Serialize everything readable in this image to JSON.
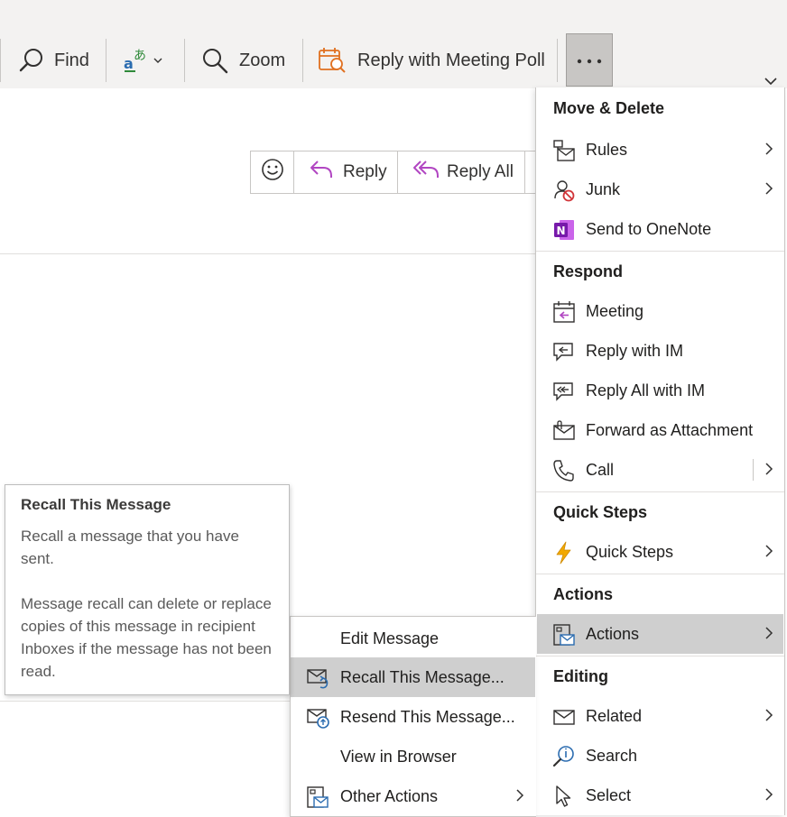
{
  "ribbon": {
    "find_label": "Find",
    "zoom_label": "Zoom",
    "meeting_poll_label": "Reply with Meeting Poll",
    "more_icon": "ellipsis-icon"
  },
  "response_bar": {
    "reply_label": "Reply",
    "reply_all_label": "Reply All"
  },
  "menu": {
    "move_delete": {
      "header": "Move & Delete",
      "items": [
        {
          "label": "Rules",
          "icon": "rules-icon",
          "submenu": true
        },
        {
          "label": "Junk",
          "icon": "junk-icon",
          "submenu": true
        },
        {
          "label": "Send to OneNote",
          "icon": "onenote-icon",
          "submenu": false
        }
      ]
    },
    "respond": {
      "header": "Respond",
      "items": [
        {
          "label": "Meeting",
          "icon": "meeting-icon",
          "submenu": false
        },
        {
          "label": "Reply with IM",
          "icon": "reply-im-icon",
          "submenu": false
        },
        {
          "label": "Reply All with IM",
          "icon": "reply-all-im-icon",
          "submenu": false
        },
        {
          "label": "Forward as Attachment",
          "icon": "forward-attachment-icon",
          "submenu": false
        },
        {
          "label": "Call",
          "icon": "phone-icon",
          "submenu": true
        }
      ]
    },
    "quick_steps": {
      "header": "Quick Steps",
      "items": [
        {
          "label": "Quick Steps",
          "icon": "lightning-icon",
          "submenu": true
        }
      ]
    },
    "actions": {
      "header": "Actions",
      "items": [
        {
          "label": "Actions",
          "icon": "actions-icon",
          "submenu": true,
          "selected": true
        }
      ]
    },
    "editing": {
      "header": "Editing",
      "items": [
        {
          "label": "Related",
          "icon": "related-icon",
          "submenu": true
        },
        {
          "label": "Search",
          "icon": "search-icon",
          "submenu": false
        },
        {
          "label": "Select",
          "icon": "select-cursor-icon",
          "submenu": true
        }
      ]
    }
  },
  "actions_submenu": {
    "items": [
      {
        "label": "Edit Message",
        "icon": "",
        "submenu": false
      },
      {
        "label": "Recall This Message...",
        "icon": "recall-icon",
        "submenu": false,
        "selected": true
      },
      {
        "label": "Resend This Message...",
        "icon": "resend-icon",
        "submenu": false
      },
      {
        "label": "View in Browser",
        "icon": "",
        "submenu": false
      },
      {
        "label": "Other Actions",
        "icon": "other-actions-icon",
        "submenu": true
      }
    ]
  },
  "tooltip": {
    "title": "Recall This Message",
    "line1": "Recall a message that you have sent.",
    "line2": "Message recall can delete or replace copies of this message in recipient Inboxes if the message has not been read."
  },
  "colors": {
    "ribbon_bg": "#f3f2f1",
    "selected_bg": "#cfcfcf",
    "accent_blue": "#2b6cb0",
    "reply_purple": "#b146c2",
    "onenote_purple": "#7719aa",
    "lightning_orange": "#f2a900",
    "poll_orange": "#e07020"
  }
}
